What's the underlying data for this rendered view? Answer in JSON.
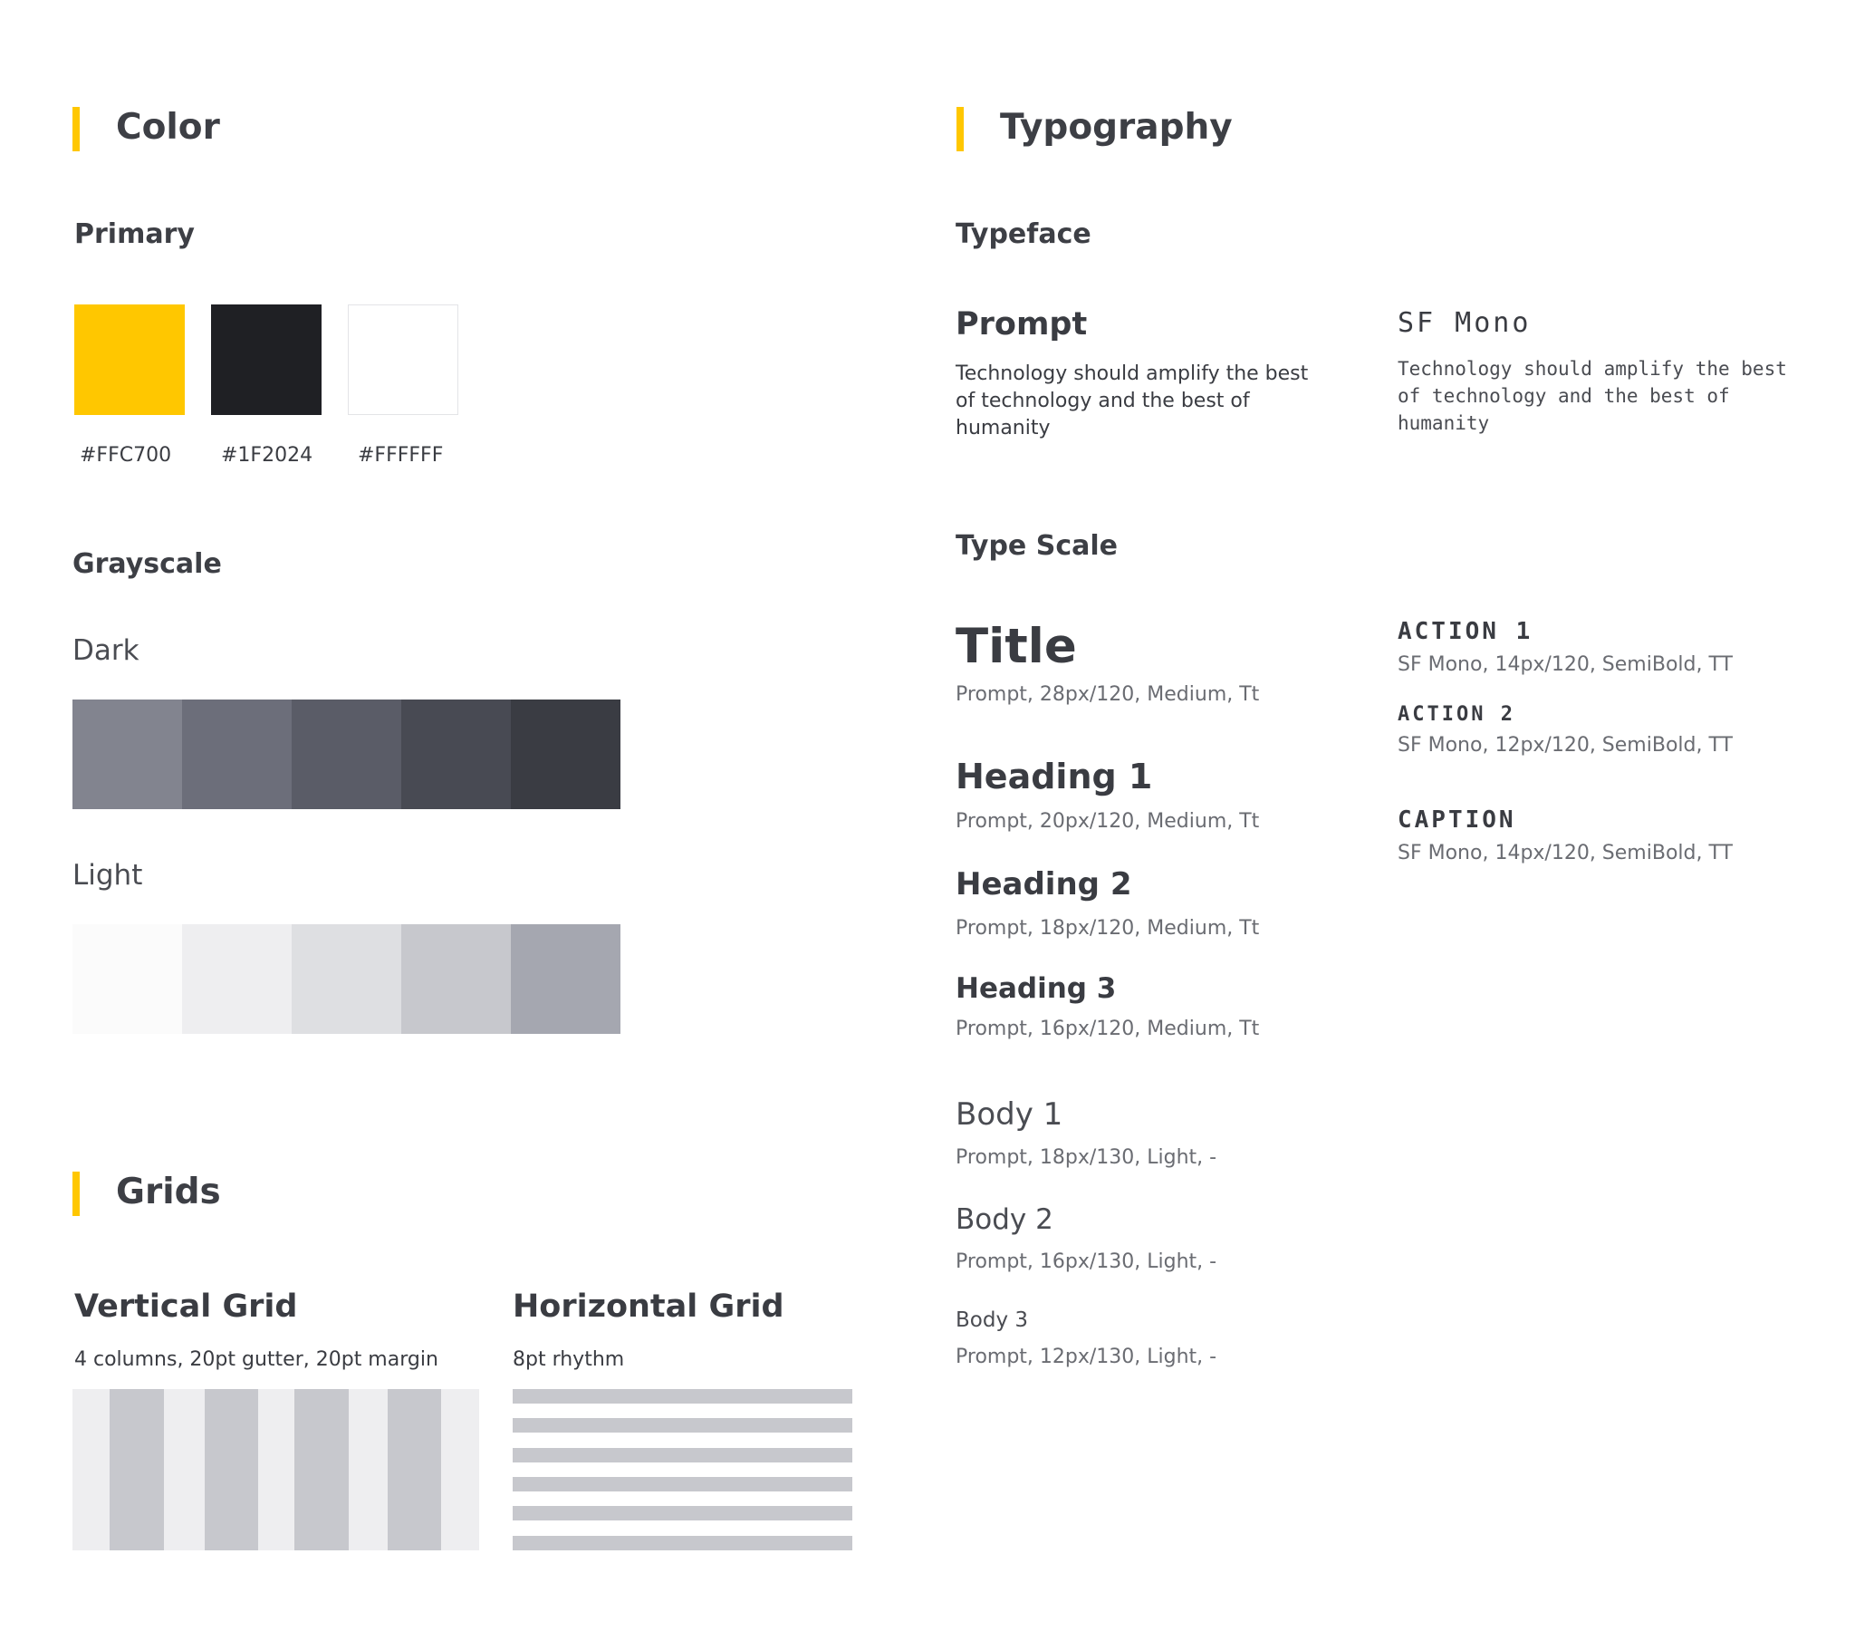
{
  "color": {
    "title": "Color",
    "accent": "#FFC700",
    "primary": {
      "label": "Primary",
      "swatches": [
        {
          "hex": "#FFC700",
          "label": "#FFC700"
        },
        {
          "hex": "#1F2024",
          "label": "#1F2024"
        },
        {
          "hex": "#FFFFFF",
          "label": "#FFFFFF"
        }
      ]
    },
    "grayscale": {
      "label": "Grayscale",
      "dark": {
        "label": "Dark",
        "shades": [
          "#82848F",
          "#6C6E7A",
          "#5A5C67",
          "#484A53",
          "#3A3C43"
        ]
      },
      "light": {
        "label": "Light",
        "shades": [
          "#FBFBFB",
          "#EEEEF0",
          "#DEDFE2",
          "#C7C8CD",
          "#A5A7B0"
        ]
      }
    }
  },
  "grids": {
    "title": "Grids",
    "vertical": {
      "title": "Vertical Grid",
      "desc": "4 columns, 20pt gutter, 20pt margin"
    },
    "horizontal": {
      "title": "Horizontal Grid",
      "desc": "8pt rhythm"
    }
  },
  "typography": {
    "title": "Typography",
    "typeface": {
      "label": "Typeface",
      "sans": {
        "name": "Prompt",
        "sample": "Technology should amplify the best of technology and the best of humanity"
      },
      "mono": {
        "name": "SF Mono",
        "sample": "Technology should amplify the best of technology and the best of humanity"
      }
    },
    "scale": {
      "label": "Type Scale",
      "sans": [
        {
          "name": "Title",
          "spec": "Prompt, 28px/120, Medium, Tt"
        },
        {
          "name": "Heading 1",
          "spec": "Prompt, 20px/120, Medium, Tt"
        },
        {
          "name": "Heading 2",
          "spec": "Prompt, 18px/120, Medium, Tt"
        },
        {
          "name": "Heading 3",
          "spec": "Prompt, 16px/120, Medium, Tt"
        },
        {
          "name": "Body 1",
          "spec": "Prompt, 18px/130, Light, -"
        },
        {
          "name": "Body 2",
          "spec": "Prompt, 16px/130, Light, -"
        },
        {
          "name": "Body 3",
          "spec": "Prompt, 12px/130, Light, -"
        }
      ],
      "mono": [
        {
          "name": "ACTION 1",
          "spec": "SF Mono, 14px/120, SemiBold, TT"
        },
        {
          "name": "ACTION 2",
          "spec": "SF Mono, 12px/120, SemiBold, TT"
        },
        {
          "name": "CAPTION",
          "spec": "SF Mono, 14px/120, SemiBold, TT"
        }
      ]
    }
  }
}
